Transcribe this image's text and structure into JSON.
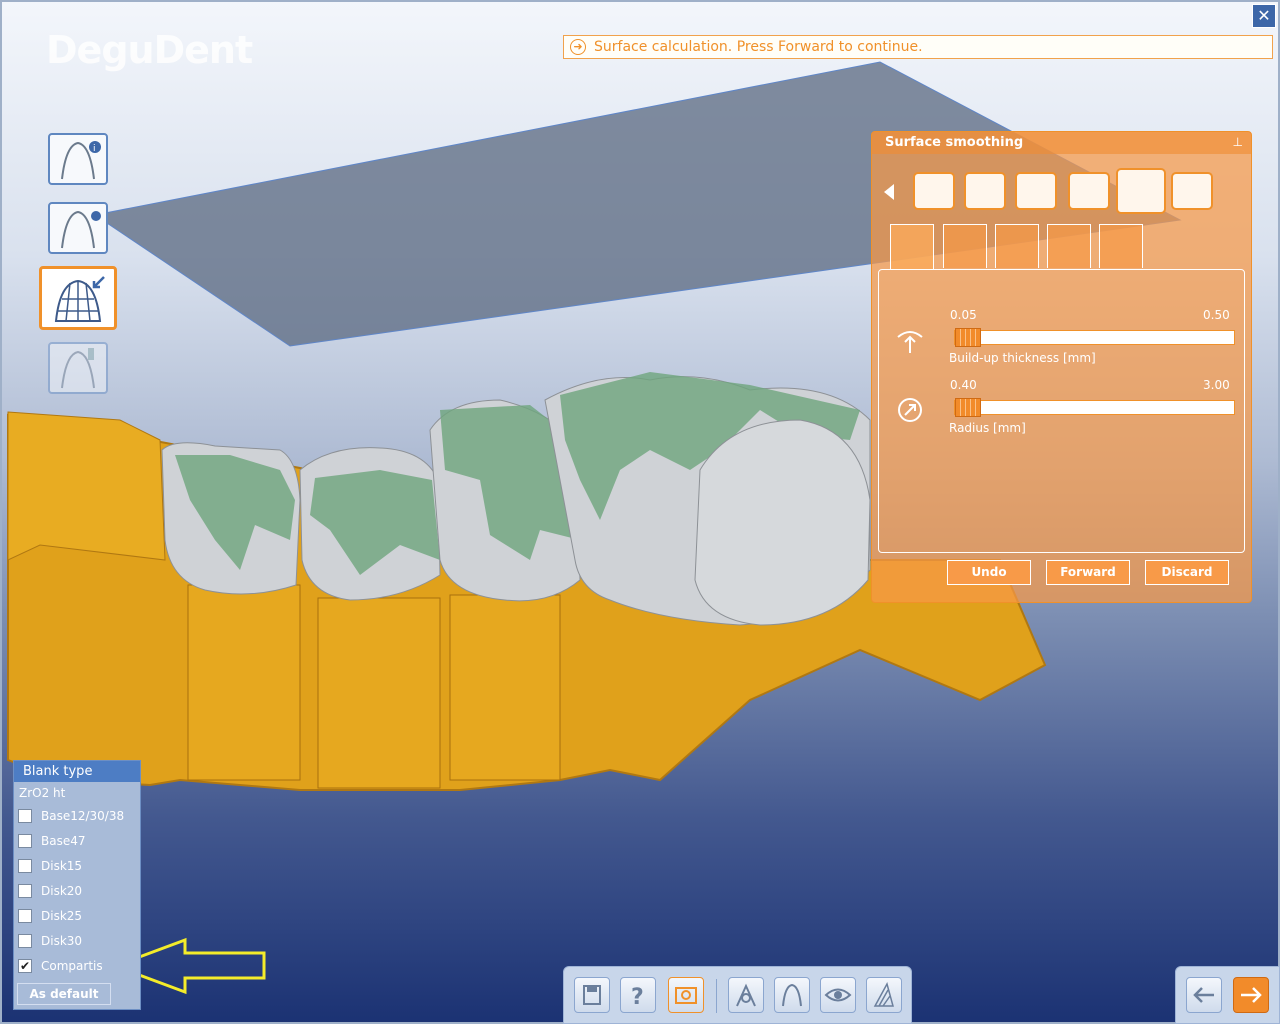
{
  "app": {
    "logo": "DeguDent",
    "close_symbol": "✕"
  },
  "status": {
    "message": "Surface calculation. Press Forward to continue."
  },
  "workflow_steps": [
    {
      "name": "preparation-info-icon",
      "state": "normal"
    },
    {
      "name": "scan-icon",
      "state": "normal"
    },
    {
      "name": "mesh-design-icon",
      "state": "active"
    },
    {
      "name": "milling-icon",
      "state": "disabled"
    }
  ],
  "smoothing_panel": {
    "title": "Surface smoothing",
    "pin_symbol": "⊥",
    "slider1": {
      "min_label": "0.05",
      "max_label": "0.50",
      "label": "Build-up thickness [mm]",
      "value": 0.05
    },
    "slider2": {
      "min_label": "0.40",
      "max_label": "3.00",
      "label": "Radius [mm]",
      "value": 0.4
    },
    "buttons": {
      "undo": "Undo",
      "forward": "Forward",
      "discard": "Discard"
    }
  },
  "blank_type": {
    "title": "Blank type",
    "material": "ZrO2 ht",
    "items": [
      {
        "label": "Base12/30/38",
        "checked": false
      },
      {
        "label": "Base47",
        "checked": false
      },
      {
        "label": "Disk15",
        "checked": false
      },
      {
        "label": "Disk20",
        "checked": false
      },
      {
        "label": "Disk25",
        "checked": false
      },
      {
        "label": "Disk30",
        "checked": false
      },
      {
        "label": "Compartis",
        "checked": true
      }
    ],
    "as_default": "As default"
  },
  "colors": {
    "accent": "#f0912a",
    "model_yellow": "#e2a21c",
    "tooth_gray": "#cfd2d6",
    "tooth_green": "#6ea57d",
    "highlight_arrow": "#f4ec2a"
  }
}
